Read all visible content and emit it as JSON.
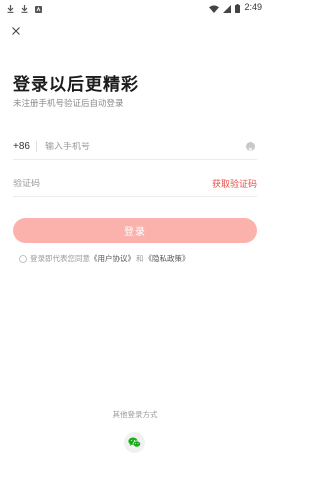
{
  "status_bar": {
    "time": "2:49",
    "left_icons": [
      "download-icon",
      "download-icon",
      "app-notification-icon"
    ],
    "right_icons": [
      "wifi-icon",
      "signal-icon",
      "battery-icon"
    ]
  },
  "header": {
    "close_icon": "close-icon"
  },
  "title": "登录以后更精彩",
  "subtitle": "未注册手机号验证后自动登录",
  "phone": {
    "country_code": "+86",
    "placeholder": "输入手机号",
    "value": "",
    "clear_icon": "clear-icon"
  },
  "code": {
    "placeholder": "验证码",
    "value": "",
    "get_code_label": "获取验证码"
  },
  "login_button": "登录",
  "agreement": {
    "checked": false,
    "prefix": "登录即代表您同意",
    "user_agreement": "《用户协议》",
    "conjunction": "和",
    "privacy_policy": "《隐私政策》"
  },
  "other_login": {
    "label": "其他登录方式",
    "wechat_icon": "wechat-icon"
  },
  "colors": {
    "accent": "#e8524a",
    "login_button_bg": "#fbb2ad",
    "divider": "#ececec"
  }
}
